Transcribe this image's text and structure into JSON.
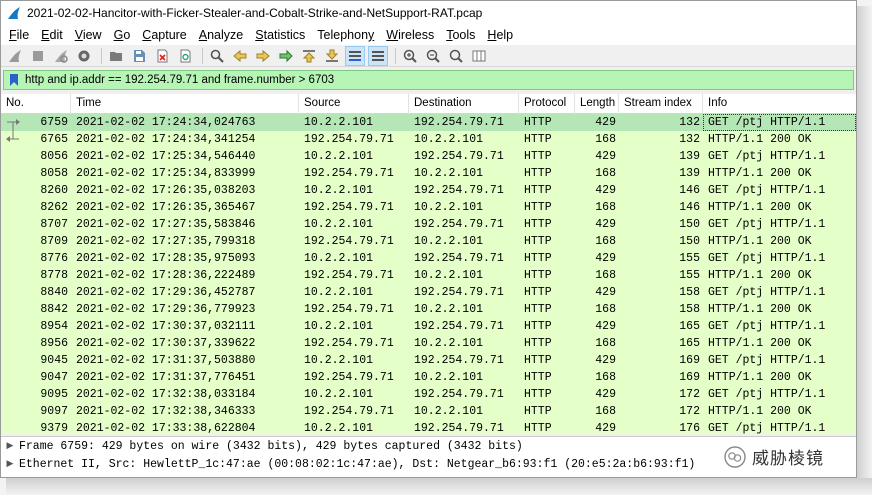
{
  "window": {
    "title": "2021-02-02-Hancitor-with-Ficker-Stealer-and-Cobalt-Strike-and-NetSupport-RAT.pcap"
  },
  "menu": [
    {
      "label": "File",
      "u": "F",
      "rest": "ile"
    },
    {
      "label": "Edit",
      "u": "E",
      "rest": "dit"
    },
    {
      "label": "View",
      "u": "V",
      "rest": "iew"
    },
    {
      "label": "Go",
      "u": "G",
      "rest": "o"
    },
    {
      "label": "Capture",
      "u": "C",
      "rest": "apture"
    },
    {
      "label": "Analyze",
      "u": "A",
      "rest": "nalyze"
    },
    {
      "label": "Statistics",
      "u": "S",
      "rest": "tatistics"
    },
    {
      "label": "Telephony",
      "u": "y",
      "rest": "Telephon"
    },
    {
      "label": "Wireless",
      "u": "W",
      "rest": "ireless"
    },
    {
      "label": "Tools",
      "u": "T",
      "rest": "ools"
    },
    {
      "label": "Help",
      "u": "H",
      "rest": "elp"
    }
  ],
  "filter": {
    "value": "http and ip.addr == 192.254.79.71 and frame.number > 6703",
    "color": "#b7f5b7"
  },
  "columns": [
    "No.",
    "Time",
    "Source",
    "Destination",
    "Protocol",
    "Length",
    "Stream index",
    "Info"
  ],
  "packets": [
    {
      "no": "6759",
      "time": "2021-02-02 17:24:34,024763",
      "src": "10.2.2.101",
      "dst": "192.254.79.71",
      "proto": "HTTP",
      "len": "429",
      "sidx": "132",
      "info": "GET /ptj HTTP/1.1"
    },
    {
      "no": "6765",
      "time": "2021-02-02 17:24:34,341254",
      "src": "192.254.79.71",
      "dst": "10.2.2.101",
      "proto": "HTTP",
      "len": "168",
      "sidx": "132",
      "info": "HTTP/1.1 200 OK"
    },
    {
      "no": "8056",
      "time": "2021-02-02 17:25:34,546440",
      "src": "10.2.2.101",
      "dst": "192.254.79.71",
      "proto": "HTTP",
      "len": "429",
      "sidx": "139",
      "info": "GET /ptj HTTP/1.1"
    },
    {
      "no": "8058",
      "time": "2021-02-02 17:25:34,833999",
      "src": "192.254.79.71",
      "dst": "10.2.2.101",
      "proto": "HTTP",
      "len": "168",
      "sidx": "139",
      "info": "HTTP/1.1 200 OK"
    },
    {
      "no": "8260",
      "time": "2021-02-02 17:26:35,038203",
      "src": "10.2.2.101",
      "dst": "192.254.79.71",
      "proto": "HTTP",
      "len": "429",
      "sidx": "146",
      "info": "GET /ptj HTTP/1.1"
    },
    {
      "no": "8262",
      "time": "2021-02-02 17:26:35,365467",
      "src": "192.254.79.71",
      "dst": "10.2.2.101",
      "proto": "HTTP",
      "len": "168",
      "sidx": "146",
      "info": "HTTP/1.1 200 OK"
    },
    {
      "no": "8707",
      "time": "2021-02-02 17:27:35,583846",
      "src": "10.2.2.101",
      "dst": "192.254.79.71",
      "proto": "HTTP",
      "len": "429",
      "sidx": "150",
      "info": "GET /ptj HTTP/1.1"
    },
    {
      "no": "8709",
      "time": "2021-02-02 17:27:35,799318",
      "src": "192.254.79.71",
      "dst": "10.2.2.101",
      "proto": "HTTP",
      "len": "168",
      "sidx": "150",
      "info": "HTTP/1.1 200 OK"
    },
    {
      "no": "8776",
      "time": "2021-02-02 17:28:35,975093",
      "src": "10.2.2.101",
      "dst": "192.254.79.71",
      "proto": "HTTP",
      "len": "429",
      "sidx": "155",
      "info": "GET /ptj HTTP/1.1"
    },
    {
      "no": "8778",
      "time": "2021-02-02 17:28:36,222489",
      "src": "192.254.79.71",
      "dst": "10.2.2.101",
      "proto": "HTTP",
      "len": "168",
      "sidx": "155",
      "info": "HTTP/1.1 200 OK"
    },
    {
      "no": "8840",
      "time": "2021-02-02 17:29:36,452787",
      "src": "10.2.2.101",
      "dst": "192.254.79.71",
      "proto": "HTTP",
      "len": "429",
      "sidx": "158",
      "info": "GET /ptj HTTP/1.1"
    },
    {
      "no": "8842",
      "time": "2021-02-02 17:29:36,779923",
      "src": "192.254.79.71",
      "dst": "10.2.2.101",
      "proto": "HTTP",
      "len": "168",
      "sidx": "158",
      "info": "HTTP/1.1 200 OK"
    },
    {
      "no": "8954",
      "time": "2021-02-02 17:30:37,032111",
      "src": "10.2.2.101",
      "dst": "192.254.79.71",
      "proto": "HTTP",
      "len": "429",
      "sidx": "165",
      "info": "GET /ptj HTTP/1.1"
    },
    {
      "no": "8956",
      "time": "2021-02-02 17:30:37,339622",
      "src": "192.254.79.71",
      "dst": "10.2.2.101",
      "proto": "HTTP",
      "len": "168",
      "sidx": "165",
      "info": "HTTP/1.1 200 OK"
    },
    {
      "no": "9045",
      "time": "2021-02-02 17:31:37,503880",
      "src": "10.2.2.101",
      "dst": "192.254.79.71",
      "proto": "HTTP",
      "len": "429",
      "sidx": "169",
      "info": "GET /ptj HTTP/1.1"
    },
    {
      "no": "9047",
      "time": "2021-02-02 17:31:37,776451",
      "src": "192.254.79.71",
      "dst": "10.2.2.101",
      "proto": "HTTP",
      "len": "168",
      "sidx": "169",
      "info": "HTTP/1.1 200 OK"
    },
    {
      "no": "9095",
      "time": "2021-02-02 17:32:38,033184",
      "src": "10.2.2.101",
      "dst": "192.254.79.71",
      "proto": "HTTP",
      "len": "429",
      "sidx": "172",
      "info": "GET /ptj HTTP/1.1"
    },
    {
      "no": "9097",
      "time": "2021-02-02 17:32:38,346333",
      "src": "192.254.79.71",
      "dst": "10.2.2.101",
      "proto": "HTTP",
      "len": "168",
      "sidx": "172",
      "info": "HTTP/1.1 200 OK"
    },
    {
      "no": "9379",
      "time": "2021-02-02 17:33:38,622804",
      "src": "10.2.2.101",
      "dst": "192.254.79.71",
      "proto": "HTTP",
      "len": "429",
      "sidx": "176",
      "info": "GET /ptj HTTP/1.1"
    }
  ],
  "details": [
    "Frame 6759: 429 bytes on wire (3432 bits), 429 bytes captured (3432 bits)",
    "Ethernet II, Src: HewlettP_1c:47:ae (00:08:02:1c:47:ae), Dst: Netgear_b6:93:f1 (20:e5:2a:b6:93:f1)"
  ],
  "watermark": "威胁棱镜",
  "colors": {
    "row_http": "#e4ffc7",
    "row_selected": "#b5e6b5",
    "filter_ok": "#b7f5b7"
  }
}
